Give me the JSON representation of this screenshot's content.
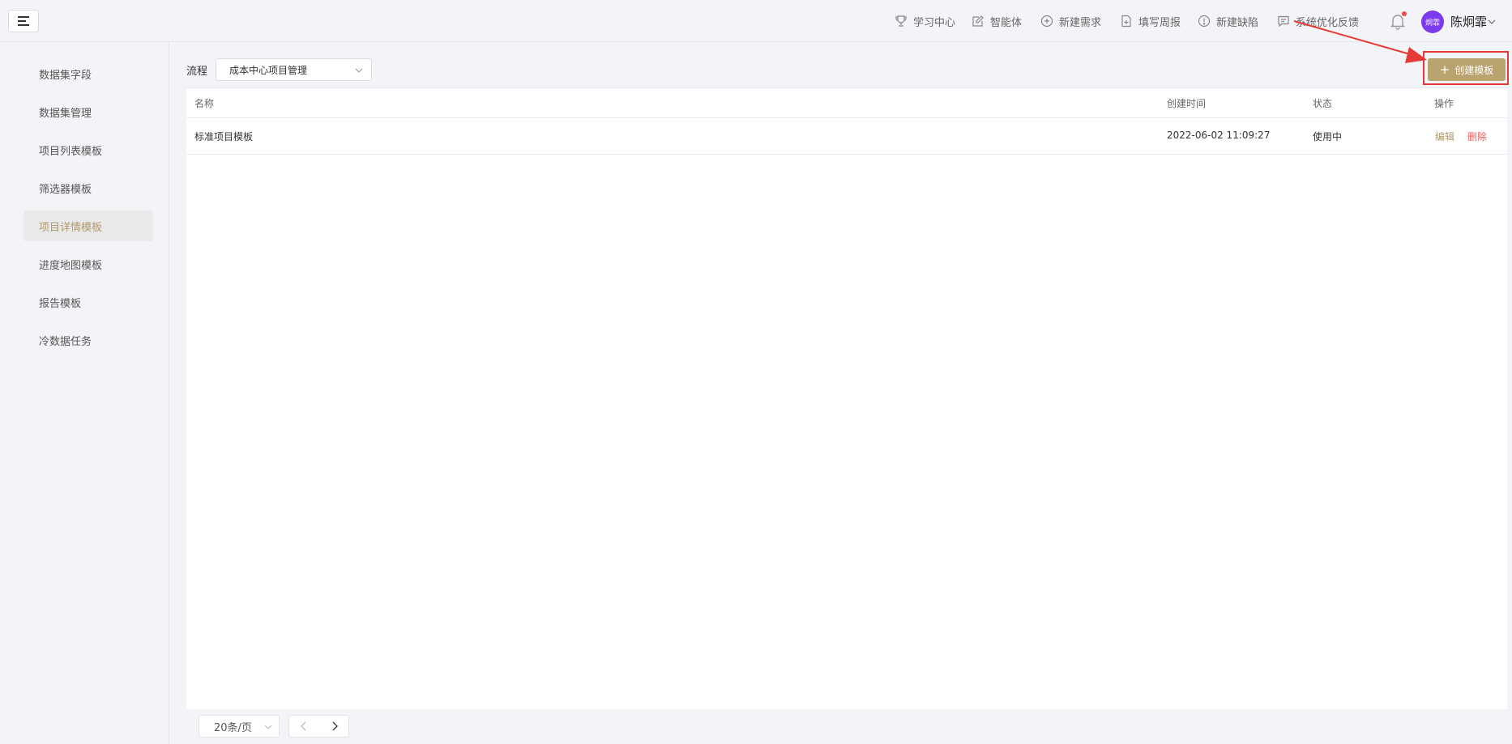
{
  "topbar": {
    "nav": [
      {
        "label": "学习中心",
        "icon": "trophy-icon"
      },
      {
        "label": "智能体",
        "icon": "edit-icon"
      },
      {
        "label": "新建需求",
        "icon": "plus-circle-icon"
      },
      {
        "label": "填写周报",
        "icon": "file-plus-icon"
      },
      {
        "label": "新建缺陷",
        "icon": "alert-circle-icon"
      },
      {
        "label": "系统优化反馈",
        "icon": "message-icon"
      }
    ],
    "avatar_text": "炯霏",
    "username": "陈炯霏"
  },
  "sidebar": {
    "items": [
      {
        "label": "数据集字段"
      },
      {
        "label": "数据集管理"
      },
      {
        "label": "项目列表模板"
      },
      {
        "label": "筛选器模板"
      },
      {
        "label": "项目详情模板",
        "active": true
      },
      {
        "label": "进度地图模板"
      },
      {
        "label": "报告模板"
      },
      {
        "label": "冷数据任务"
      }
    ]
  },
  "filter": {
    "label": "流程",
    "value": "成本中心项目管理"
  },
  "create_button": {
    "label": "创建模板"
  },
  "table": {
    "headers": {
      "name": "名称",
      "created": "创建时间",
      "status": "状态",
      "actions": "操作"
    },
    "rows": [
      {
        "name": "标准项目模板",
        "created": "2022-06-02 11:09:27",
        "status": "使用中",
        "edit": "编辑",
        "delete": "删除"
      }
    ]
  },
  "pagination": {
    "page_size": "20条/页"
  },
  "colors": {
    "accent": "#b9a36e",
    "danger": "#f06060",
    "annotation": "#e53935",
    "avatar": "#7c3aed"
  }
}
